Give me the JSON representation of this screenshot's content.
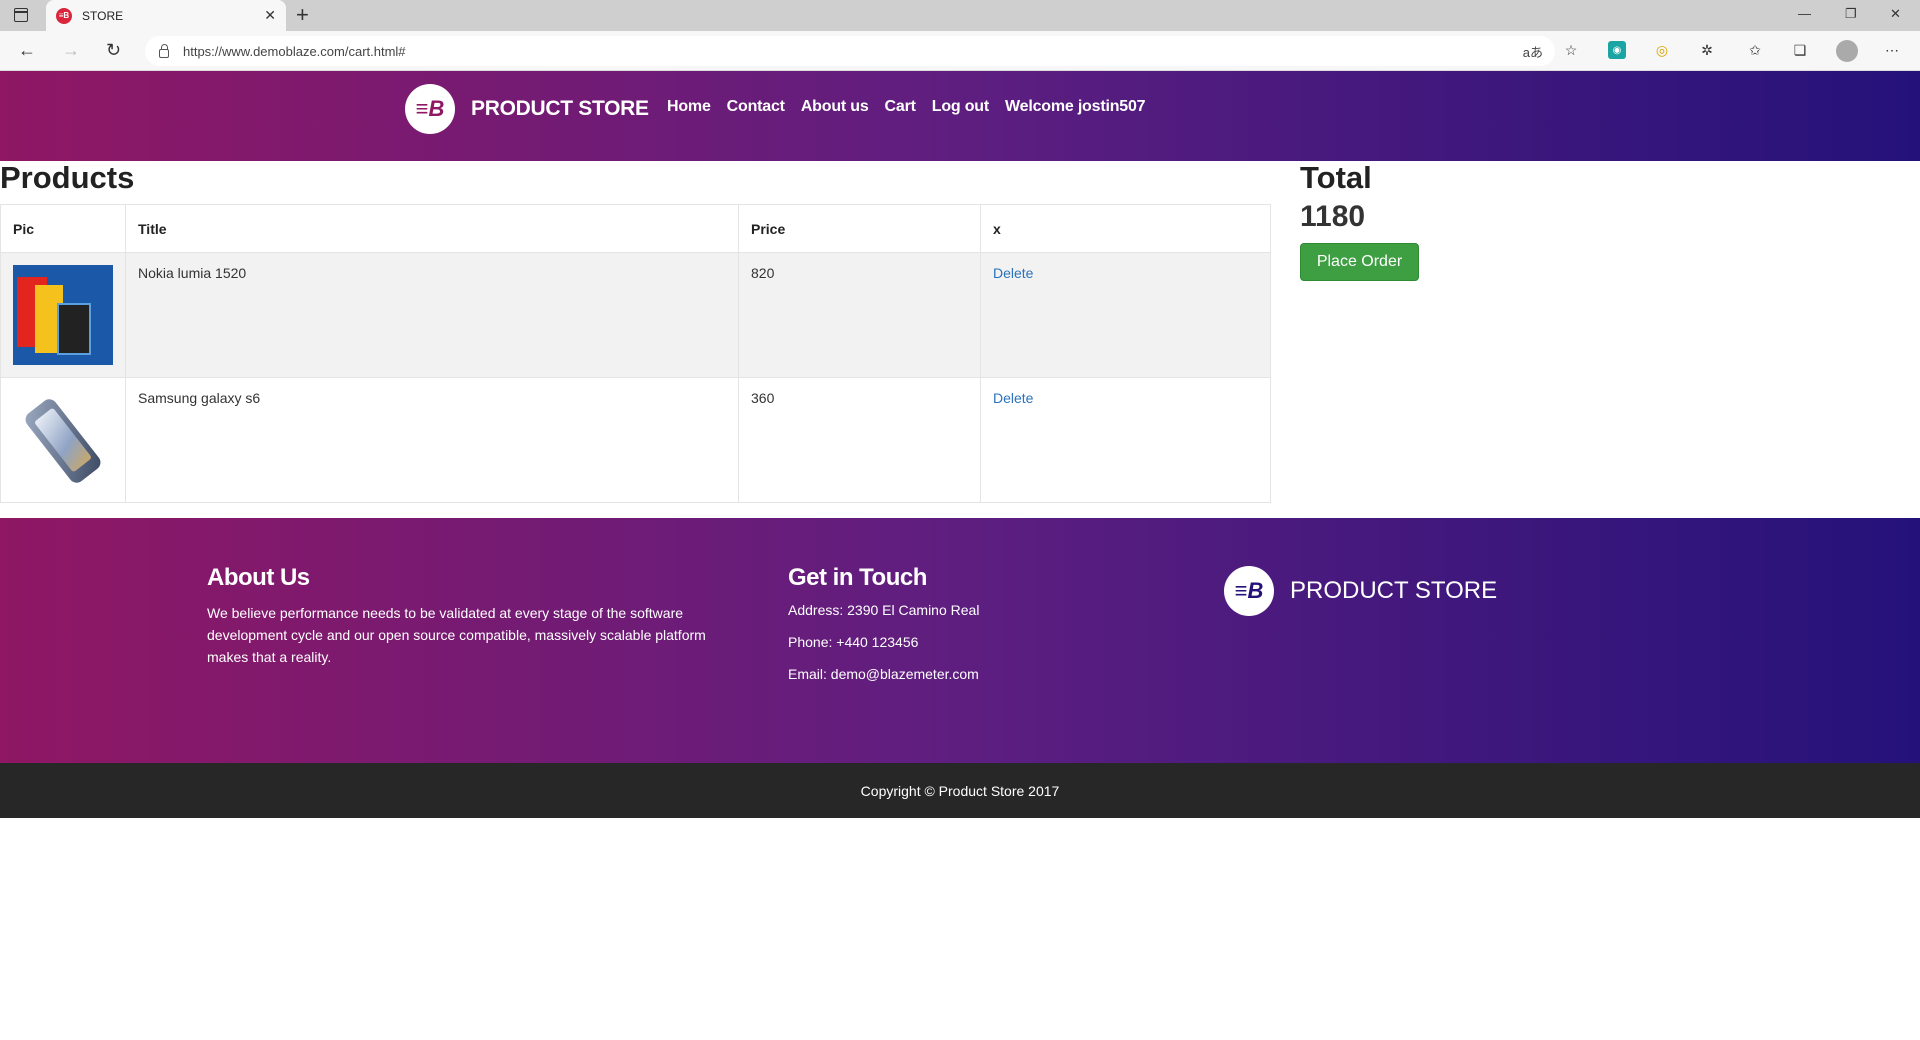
{
  "browser": {
    "tab_title": "STORE",
    "tab_favicon": "≡B",
    "close_glyph": "✕",
    "new_tab_glyph": "+",
    "url": "https://www.demoblaze.com/cart.html#",
    "read_aloud": "aあ",
    "window": {
      "minimize": "—",
      "restore": "❐",
      "close": "✕"
    }
  },
  "site": {
    "brand_logo": "≡B",
    "brand_name": "PRODUCT STORE",
    "nav": [
      "Home",
      "Contact",
      "About us",
      "Cart",
      "Log out",
      "Welcome jostin507"
    ]
  },
  "cart": {
    "heading": "Products",
    "columns": [
      "Pic",
      "Title",
      "Price",
      "x"
    ],
    "rows": [
      {
        "image": "nokia-lumia-image",
        "title": "Nokia lumia 1520",
        "price": "820",
        "action": "Delete"
      },
      {
        "image": "samsung-galaxy-image",
        "title": "Samsung galaxy s6",
        "price": "360",
        "action": "Delete"
      }
    ],
    "total_heading": "Total",
    "total_value": "1180",
    "place_order_label": "Place Order"
  },
  "footer": {
    "about_heading": "About Us",
    "about_text": "We believe performance needs to be validated at every stage of the software development cycle and our open source compatible, massively scalable platform makes that a reality.",
    "contact_heading": "Get in Touch",
    "address": "Address: 2390 El Camino Real",
    "phone": "Phone: +440 123456",
    "email": "Email: demo@blazemeter.com",
    "brand_name": "PRODUCT STORE",
    "copyright": "Copyright © Product Store 2017"
  },
  "colors": {
    "gradient_start": "#8f1764",
    "gradient_end": "#24127a",
    "place_order_bg": "#3d9e42",
    "link": "#2a73b9",
    "copyright_bg": "#272727"
  }
}
